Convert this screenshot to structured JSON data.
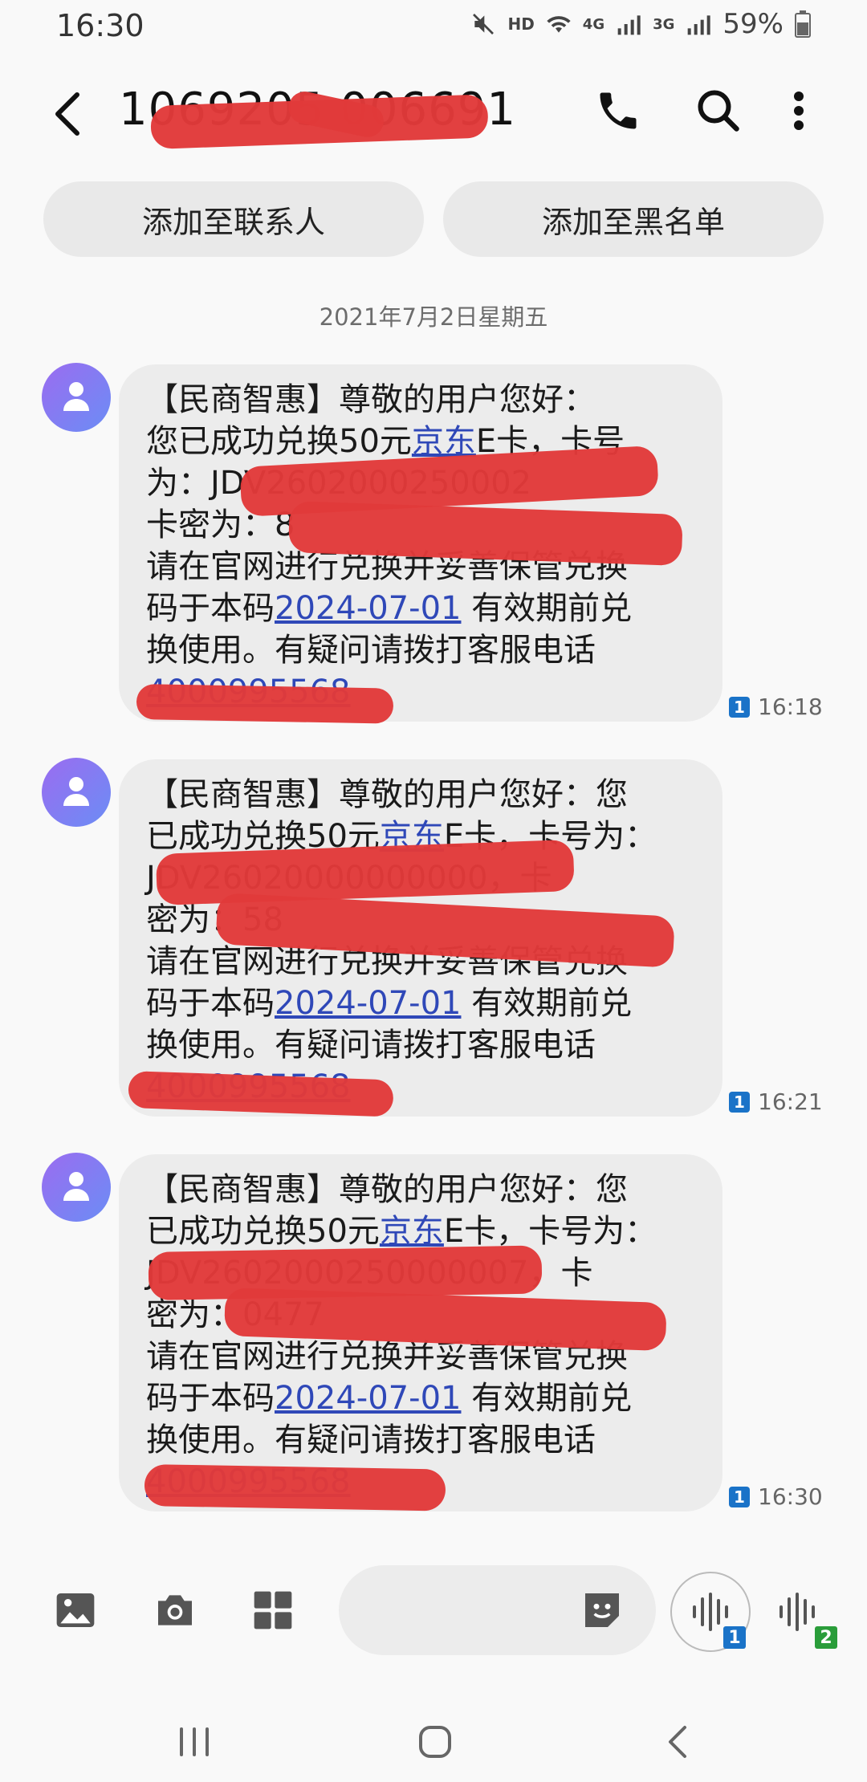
{
  "status": {
    "time": "16:30",
    "hd": "HD",
    "net1": "4G",
    "net2": "3G",
    "battery": "59%"
  },
  "header": {
    "title": "1069205 006691"
  },
  "actions": {
    "add_contact": "添加至联系人",
    "add_blocklist": "添加至黑名单"
  },
  "date": "2021年7月2日星期五",
  "messages": [
    {
      "time": "16:18",
      "sim": "1",
      "l1": "【民商智惠】尊敬的用户您好：",
      "l2a": "您已成功兑换50元",
      "l2link": "京东",
      "l2b": "E卡，卡号",
      "l3": "为：JDV2602000250002",
      "l4": "卡密为：8",
      "l5": "请在官网进行兑换并妥善保管兑换",
      "l6a": "码于本码",
      "l6link": "2024-07-01",
      "l6b": " 有效期前兑",
      "l7": "换使用。有疑问请拨打客服电话",
      "l8": "4000995568"
    },
    {
      "time": "16:21",
      "sim": "1",
      "l1": "【民商智惠】尊敬的用户您好：您",
      "l2a": "已成功兑换50元",
      "l2link": "京东",
      "l2b": "E卡，卡号为：",
      "l3": "JDV26020000000000，卡",
      "l4": "密为：58",
      "l5": "请在官网进行兑换并妥善保管兑换",
      "l6a": "码于本码",
      "l6link": "2024-07-01",
      "l6b": " 有效期前兑",
      "l7": "换使用。有疑问请拨打客服电话",
      "l8": "4000995568"
    },
    {
      "time": "16:30",
      "sim": "1",
      "l1": "【民商智惠】尊敬的用户您好：您",
      "l2a": "已成功兑换50元",
      "l2link": "京东",
      "l2b": "E卡，卡号为：",
      "l3": "JDV2602000250000007，卡",
      "l4": "密为：0477",
      "l5": "请在官网进行兑换并妥善保管兑换",
      "l6a": "码于本码",
      "l6link": "2024-07-01",
      "l6b": " 有效期前兑",
      "l7": "换使用。有疑问请拨打客服电话",
      "l8": "4000995568"
    }
  ],
  "composer": {
    "voice1_badge": "1",
    "voice2_badge": "2"
  },
  "colors": {
    "link": "#2f48b8",
    "redaction": "#e13a3a",
    "sim_badge": "#1a73c8",
    "sim2_badge": "#2a9d3a"
  }
}
